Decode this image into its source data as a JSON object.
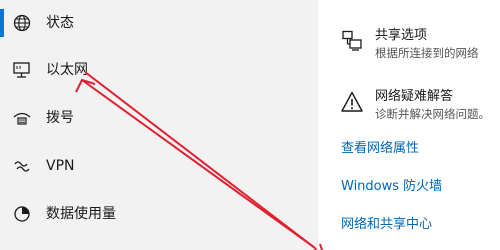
{
  "sidebar": {
    "items": [
      {
        "label": "状态",
        "icon": "status-globe-icon",
        "selected": true
      },
      {
        "label": "以太网",
        "icon": "ethernet-icon",
        "selected": false
      },
      {
        "label": "拨号",
        "icon": "dialup-icon",
        "selected": false
      },
      {
        "label": "VPN",
        "icon": "vpn-icon",
        "selected": false
      },
      {
        "label": "数据使用量",
        "icon": "data-usage-icon",
        "selected": false
      }
    ]
  },
  "main": {
    "options": [
      {
        "title": "共享选项",
        "desc": "根据所连接到的网络",
        "icon": "sharing-icon"
      },
      {
        "title": "网络疑难解答",
        "desc": "诊断并解决网络问题。",
        "icon": "warning-icon"
      }
    ],
    "links": [
      {
        "label": "查看网络属性"
      },
      {
        "label": "Windows 防火墙"
      },
      {
        "label": "网络和共享中心"
      }
    ]
  },
  "colors": {
    "accent": "#0078d7",
    "link": "#0067b8",
    "annotation_arrow": "#e02030"
  }
}
